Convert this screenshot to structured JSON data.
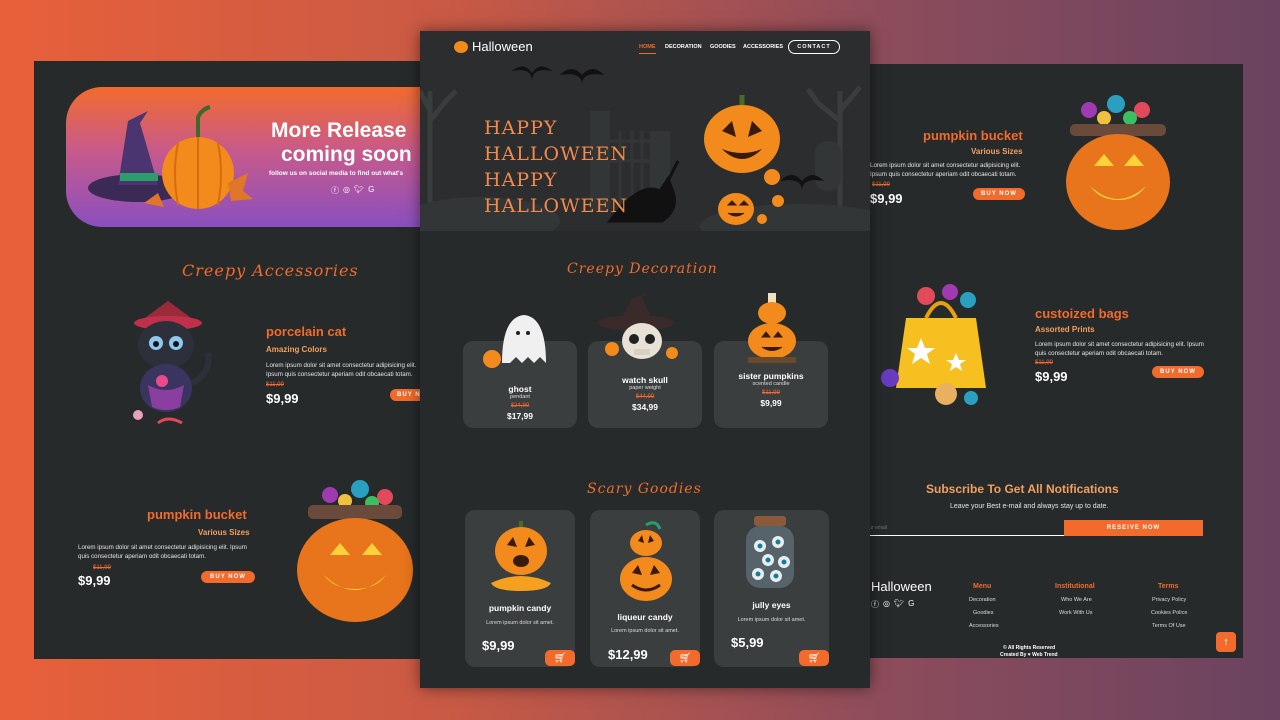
{
  "brand": {
    "name": "Halloween"
  },
  "nav": {
    "items": [
      "HOME",
      "DECORATION",
      "GOODIES",
      "ACCESSORIES"
    ],
    "contact": "CONTACT"
  },
  "hero": {
    "line1": "HAPPY",
    "line2": "HALLOWEEN",
    "line3": "HAPPY",
    "line4": "HALLOWEEN"
  },
  "release": {
    "title1": "More Release",
    "title2": "coming soon",
    "sub": "follow us on social media to find out what's"
  },
  "accessories": {
    "heading": "Creepy Accessories",
    "product": {
      "name": "porcelain cat",
      "sub": "Amazing Colors",
      "desc": "Lorem ipsum dolor sit amet consectetur adipisicing elit. Ipsum quis consectetur aperiam odit obcaecati totam.",
      "old_price": "$11,99",
      "price": "$9,99",
      "button": "BUY NOW"
    }
  },
  "left_bucket": {
    "name": "pumpkin bucket",
    "sub": "Various Sizes",
    "desc": "Lorem ipsum dolor sit amet consectetur adipisicing elit. Ipsum quis consectetur aperiam odit obcaecati totam.",
    "old_price": "$11,99",
    "price": "$9,99",
    "button": "BUY NOW"
  },
  "decoration": {
    "heading": "Creepy Decoration",
    "items": [
      {
        "name": "ghost",
        "sub": "pendant",
        "old": "$24,99",
        "price": "$17,99"
      },
      {
        "name": "watch skull",
        "sub": "paper weight",
        "old": "$44,99",
        "price": "$34,99"
      },
      {
        "name": "sister pumpkins",
        "sub": "scented candle",
        "old": "$11,99",
        "price": "$9,99"
      }
    ]
  },
  "goodies": {
    "heading": "Scary Goodies",
    "items": [
      {
        "name": "pumpkin candy",
        "desc": "Lorem ipsum dolor sit amet.",
        "price": "$9,99"
      },
      {
        "name": "liqueur candy",
        "desc": "Lorem ipsum dolor sit amet.",
        "price": "$12,99"
      },
      {
        "name": "jully eyes",
        "desc": "Lorem ipsum dolor sit amet.",
        "price": "$5,99"
      }
    ]
  },
  "right_bucket": {
    "name": "pumpkin bucket",
    "sub": "Various Sizes",
    "desc": "Lorem ipsum dolor sit amet consectetur adipisicing elit. Ipsum quis consectetur aperiam odit obcaecati totam.",
    "old_price": "$11,99",
    "price": "$9,99",
    "button": "BUY NOW"
  },
  "bags": {
    "name": "custoized bags",
    "sub": "Assorted Prints",
    "desc": "Lorem ipsum dolor sit amet consectetur adipisicing elit. Ipsum quis consectetur aperiam odit obcaecati totam.",
    "old_price": "$11,99",
    "price": "$9,99",
    "button": "BUY NOW"
  },
  "subscribe": {
    "title": "Subscribe To Get All Notifications",
    "text": "Leave your Best e-mail and always stay up to date.",
    "placeholder": "your email",
    "button": "RESEIVE NOW"
  },
  "footer": {
    "brand": "Halloween",
    "menu": {
      "title": "Menu",
      "links": [
        "Decoration",
        "Goodies",
        "Accessories"
      ]
    },
    "institutional": {
      "title": "Institutional",
      "links": [
        "Who We Are",
        "Work With Us"
      ]
    },
    "terms": {
      "title": "Terms",
      "links": [
        "Privacy Policy",
        "Cookies Police",
        "Terms Of Use"
      ]
    },
    "rights": "© All Rights Reserved",
    "credit": "Created By ♥ Web Trend"
  },
  "colors": {
    "accent": "#f26b2c",
    "panel": "#262a2b",
    "card": "#3a3e3f"
  }
}
